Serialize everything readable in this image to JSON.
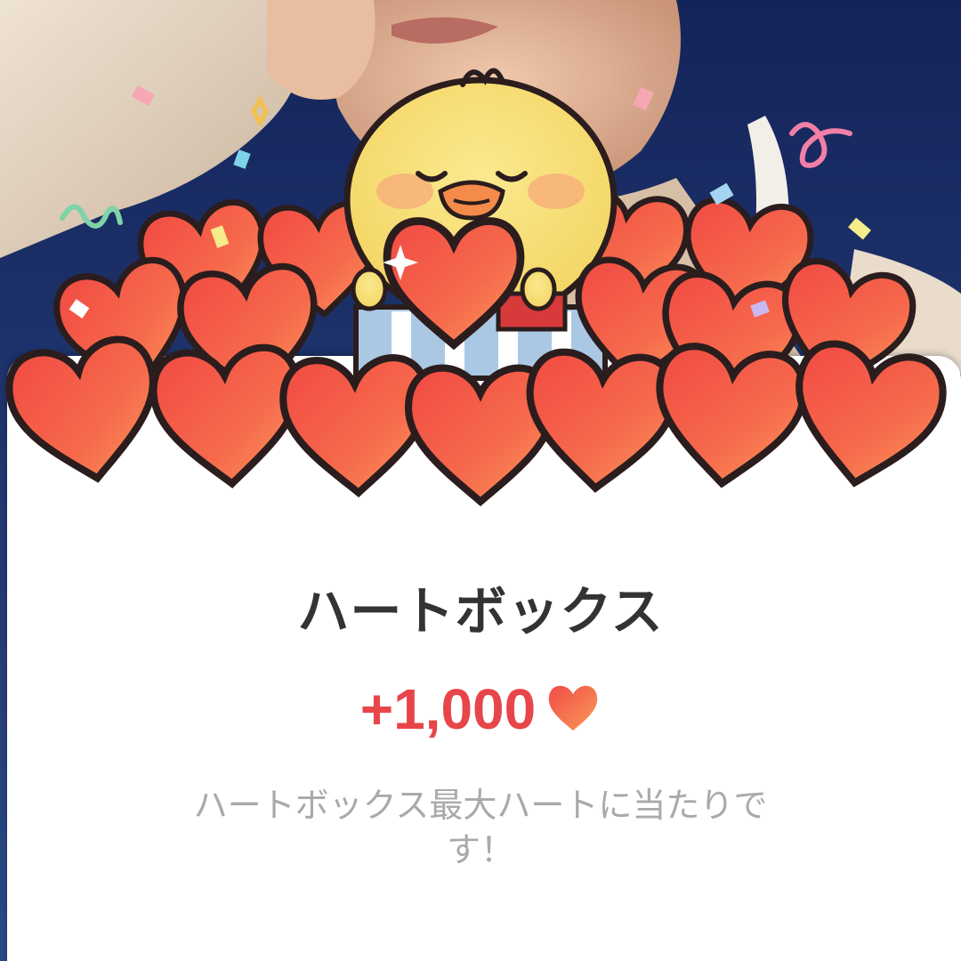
{
  "dialog": {
    "title": "ハートボックス",
    "reward_amount": "+1,000",
    "reward_icon": "heart-icon",
    "message": "ハートボックス最大ハートに当たりです！"
  },
  "colors": {
    "accent": "#e8454a",
    "title_text": "#333333",
    "message_text": "#a9a9a9",
    "card_background": "#ffffff",
    "heart_fill": "#f4574d",
    "heart_outline": "#2b1d1d",
    "chick_yellow": "#f9e27a",
    "background_blue": "#1d3266"
  },
  "icons": [
    "heart-icon",
    "sparkle-icon",
    "confetti",
    "chick-mascot",
    "gift-box"
  ]
}
